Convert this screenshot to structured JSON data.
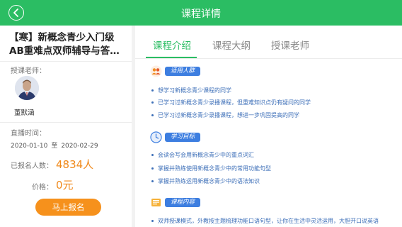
{
  "header": {
    "title": "课程详情"
  },
  "course": {
    "title_line1": "【寒】新概念青少入门级",
    "title_line2": "AB重难点双师辅导与答疑...",
    "teacher_label": "授课老师：",
    "teacher_name": "董默涵",
    "time_label": "直播时间：",
    "start_date": "2020-01-10",
    "date_sep": "至",
    "end_date": "2020-02-29",
    "enrolled_label": "已报名人数：",
    "enrolled_count": "4834人",
    "price_label": "价格：",
    "price": "0元",
    "signup_button": "马上报名"
  },
  "tabs": [
    {
      "label": "课程介绍",
      "active": true
    },
    {
      "label": "课程大纲",
      "active": false
    },
    {
      "label": "授课老师",
      "active": false
    }
  ],
  "sections": [
    {
      "badge": "适用人群",
      "icon": "people-icon",
      "items": [
        "想学习新概念青少课程的同学",
        "已学习过新概念青少录播课程，但重难知识点仍有疑问的同学",
        "已学习过新概念青少录播课程，想进一步巩固提高的同学"
      ]
    },
    {
      "badge": "学习目标",
      "icon": "clock-icon",
      "items": [
        "会读会写会用新概念青少中的重点词汇",
        "掌握并熟练使用新概念青少中的常用功能句型",
        "掌握并熟练运用新概念青少中的语法知识"
      ]
    },
    {
      "badge": "课程内容",
      "icon": "book-icon",
      "items": [
        "双师授课模式，外教按主题梳理功能口语句型，让你在生活中灵活运用，大胆开口说英语"
      ]
    }
  ],
  "colors": {
    "brand_green": "#2bbd63",
    "accent_orange": "#f08a1c",
    "badge_blue": "#3d7ee0"
  }
}
